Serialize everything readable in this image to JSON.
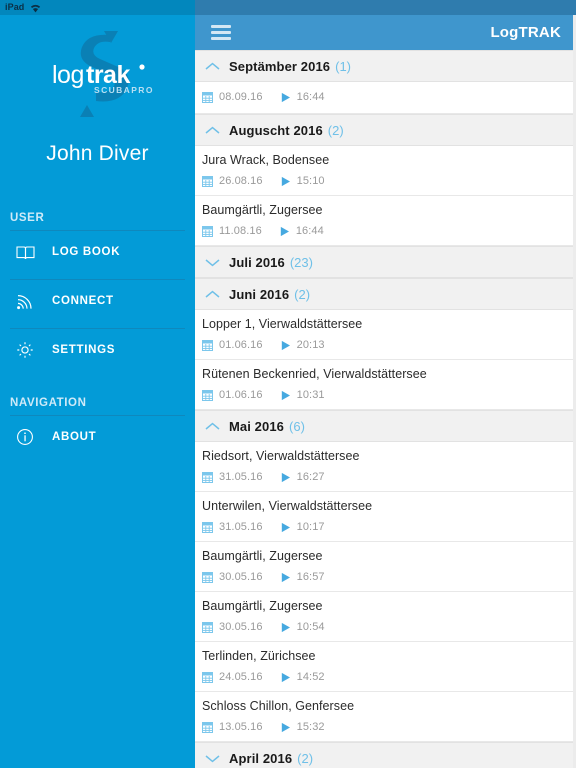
{
  "status_bar": {
    "device_label": "iPad",
    "wifi_icon": "wifi-icon"
  },
  "sidebar": {
    "brand": {
      "logo_text_light": "log",
      "logo_text_bold": "trak",
      "logo_sub": "SCUBAPRO",
      "watermark_icon": "scubapro-s-icon"
    },
    "username": "John Diver",
    "groups": [
      {
        "label": "USER",
        "items": [
          {
            "label": "LOG BOOK",
            "icon": "book-icon"
          },
          {
            "label": "CONNECT",
            "icon": "wireless-signal-icon"
          },
          {
            "label": "SETTINGS",
            "icon": "gear-icon"
          }
        ]
      },
      {
        "label": "NAVIGATION",
        "items": [
          {
            "label": "ABOUT",
            "icon": "info-circle-icon"
          }
        ]
      }
    ]
  },
  "header": {
    "menu_icon": "hamburger-icon",
    "title": "LogTRAK"
  },
  "colors": {
    "sidebar_blue": "#039bd7",
    "sidebar_blue_dark": "#0287bd",
    "header_blue": "#3f96cd",
    "header_blue_dark": "#2f7cae",
    "accent_light_blue": "#6fc0e8",
    "group_bg": "#f1f1f1",
    "row_bg": "#ffffff",
    "meta_text": "#9a9a9a",
    "title_text": "#2b2b2b"
  },
  "icons": {
    "calendar": "calendar-icon",
    "play": "play-icon",
    "chevron_up": "chevron-up-icon",
    "chevron_down": "chevron-down-icon"
  },
  "logbook": {
    "sections": [
      {
        "title": "Septämber 2016",
        "count": "(1)",
        "expanded": true,
        "chevron": "chevron-up-icon",
        "dives": [
          {
            "title": "",
            "date": "08.09.16",
            "time": "16:44"
          }
        ]
      },
      {
        "title": "Auguscht 2016",
        "count": "(2)",
        "expanded": true,
        "chevron": "chevron-up-icon",
        "dives": [
          {
            "title": "Jura Wrack, Bodensee",
            "date": "26.08.16",
            "time": "15:10"
          },
          {
            "title": "Baumgärtli, Zugersee",
            "date": "11.08.16",
            "time": "16:44"
          }
        ]
      },
      {
        "title": "Juli 2016",
        "count": "(23)",
        "expanded": false,
        "chevron": "chevron-down-icon",
        "dives": []
      },
      {
        "title": "Juni 2016",
        "count": "(2)",
        "expanded": true,
        "chevron": "chevron-up-icon",
        "dives": [
          {
            "title": "Lopper 1, Vierwaldstättersee",
            "date": "01.06.16",
            "time": "20:13"
          },
          {
            "title": "Rütenen Beckenried, Vierwaldstättersee",
            "date": "01.06.16",
            "time": "10:31"
          }
        ]
      },
      {
        "title": "Mai 2016",
        "count": "(6)",
        "expanded": true,
        "chevron": "chevron-up-icon",
        "dives": [
          {
            "title": "Riedsort, Vierwaldstättersee",
            "date": "31.05.16",
            "time": "16:27"
          },
          {
            "title": "Unterwilen, Vierwaldstättersee",
            "date": "31.05.16",
            "time": "10:17"
          },
          {
            "title": "Baumgärtli, Zugersee",
            "date": "30.05.16",
            "time": "16:57"
          },
          {
            "title": "Baumgärtli, Zugersee",
            "date": "30.05.16",
            "time": "10:54"
          },
          {
            "title": "Terlinden, Zürichsee",
            "date": "24.05.16",
            "time": "14:52"
          },
          {
            "title": "Schloss Chillon, Genfersee",
            "date": "13.05.16",
            "time": "15:32"
          }
        ]
      },
      {
        "title": "April 2016",
        "count": "(2)",
        "expanded": false,
        "chevron": "chevron-down-icon",
        "dives": []
      }
    ]
  }
}
